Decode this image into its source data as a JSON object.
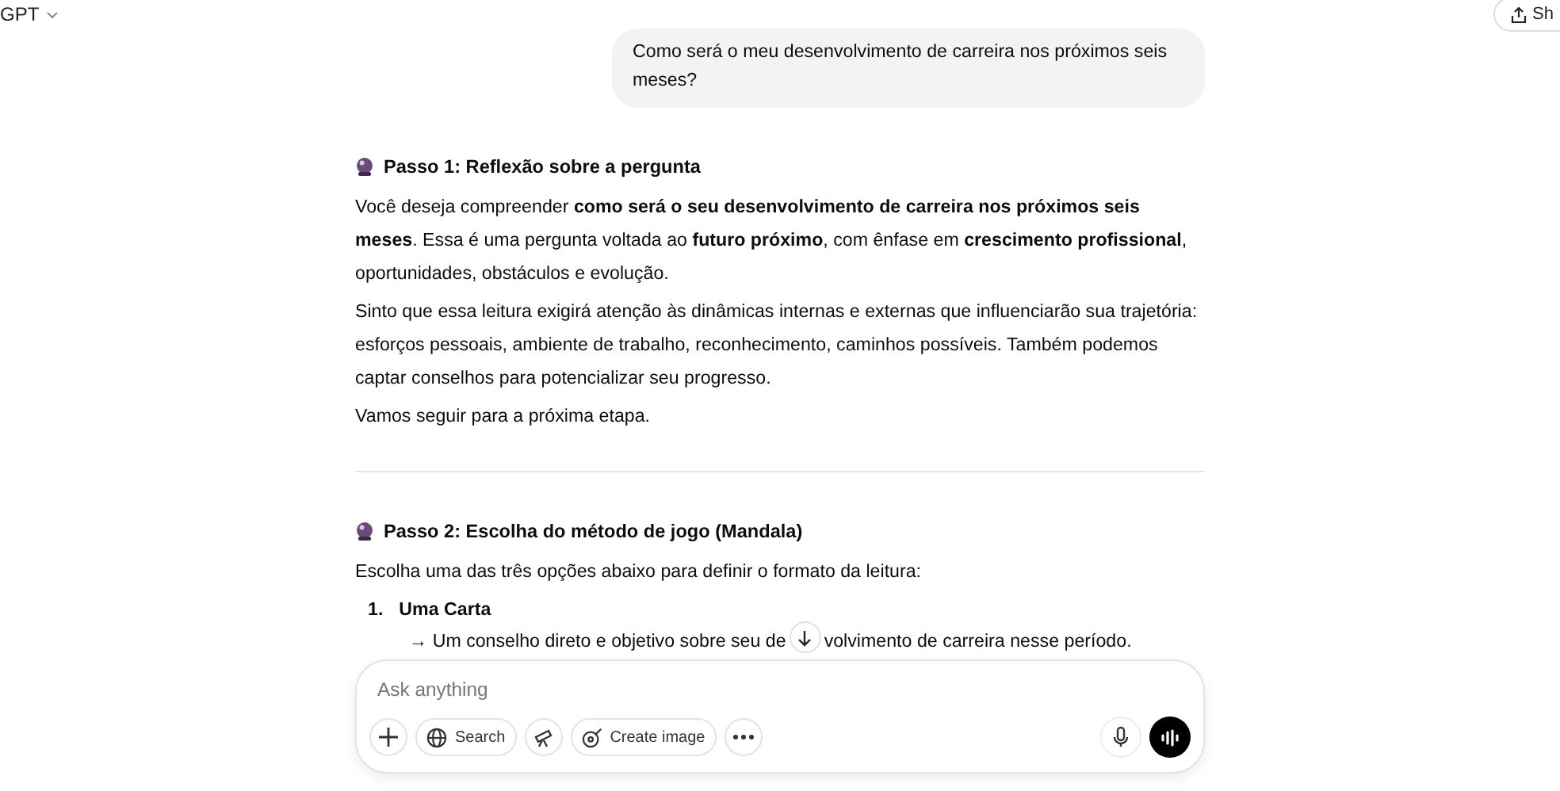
{
  "header": {
    "model": "GPT",
    "share_label": "Sh"
  },
  "user_message": "Como será o meu desenvolvimento de carreira nos próximos seis meses?",
  "steps": [
    {
      "title": "Passo 1: Reflexão sobre a pergunta",
      "paragraphs": [
        "Você deseja compreender **como será o seu desenvolvimento de carreira nos próximos seis meses**. Essa é uma pergunta voltada ao **futuro próximo**, com ênfase em **crescimento profissional**, oportunidades, obstáculos e evolução.",
        "Sinto que essa leitura exigirá atenção às dinâmicas internas e externas que influenciarão sua trajetória: esforços pessoais, ambiente de trabalho, reconhecimento, caminhos possíveis. Também podemos captar conselhos para potencializar seu progresso.",
        "Vamos seguir para a próxima etapa."
      ]
    },
    {
      "title": "Passo 2: Escolha do método de jogo (Mandala)",
      "paragraphs": [
        "Escolha uma das três opções abaixo para definir o formato da leitura:"
      ],
      "options": [
        {
          "number": "1.",
          "title": "Uma Carta",
          "description_before": "→ Um conselho direto e objetivo sobre seu de",
          "description_after": "volvimento de carreira nesse período."
        }
      ]
    }
  ],
  "composer": {
    "placeholder": "Ask anything",
    "tools": [
      {
        "kind": "plus"
      },
      {
        "kind": "search",
        "label": "Search"
      },
      {
        "kind": "telescope"
      },
      {
        "kind": "create-image",
        "label": "Create image"
      },
      {
        "kind": "more"
      }
    ]
  }
}
